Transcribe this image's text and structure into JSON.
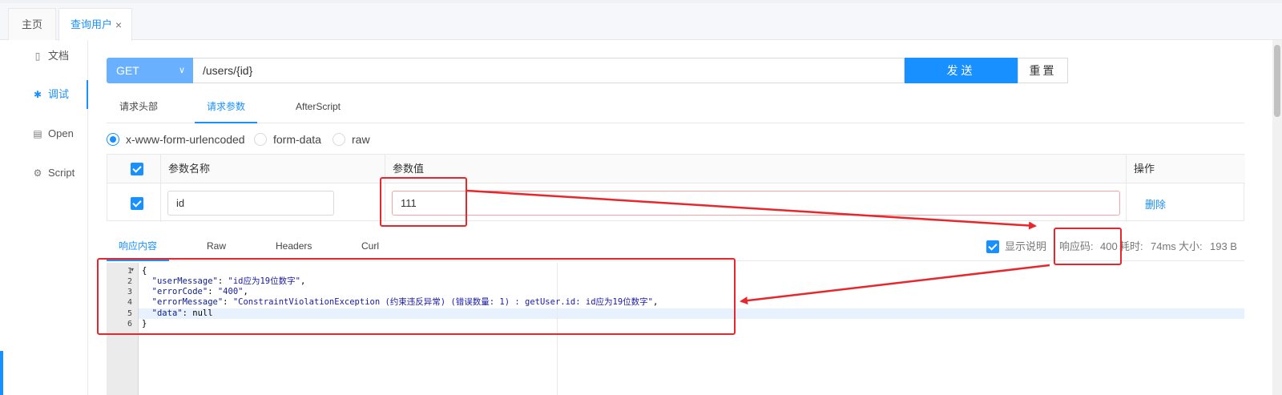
{
  "tabs": [
    {
      "label": "主页"
    },
    {
      "label": "查询用户",
      "close": "×"
    }
  ],
  "sidebar": {
    "items": [
      {
        "label": "文档",
        "icon": "doc-icon"
      },
      {
        "label": "调试",
        "icon": "bug-icon",
        "active": true
      },
      {
        "label": "Open",
        "icon": "file-icon"
      },
      {
        "label": "Script",
        "icon": "gear-icon"
      }
    ]
  },
  "request": {
    "method": "GET",
    "url": "/users/{id}",
    "send_label": "发送",
    "reset_label": "重置"
  },
  "request_tabs": [
    {
      "label": "请求头部"
    },
    {
      "label": "请求参数",
      "active": true
    },
    {
      "label": "AfterScript"
    }
  ],
  "body_types": [
    {
      "label": "x-www-form-urlencoded",
      "selected": true
    },
    {
      "label": "form-data"
    },
    {
      "label": "raw"
    }
  ],
  "params_table": {
    "headers": [
      "参数名称",
      "参数值",
      "操作"
    ],
    "rows": [
      {
        "name": "id",
        "value": "111",
        "action": "删除",
        "checked": true
      }
    ]
  },
  "response_tabs": [
    {
      "label": "响应内容",
      "active": true
    },
    {
      "label": "Raw"
    },
    {
      "label": "Headers"
    },
    {
      "label": "Curl"
    }
  ],
  "response_info": {
    "show_desc_label": "显示说明",
    "code_label": "响应码:",
    "code": "400",
    "time_label": "耗时:",
    "time": "74ms",
    "size_label": "大小:",
    "size": "193 B"
  },
  "response_body": {
    "line_numbers": [
      "1",
      "2",
      "3",
      "4",
      "5",
      "6"
    ],
    "open_brace": "{",
    "close_brace": "}",
    "lines": [
      {
        "key": "\"userMessage\"",
        "sep": ": ",
        "value": "\"id应为19位数字\"",
        "end": ","
      },
      {
        "key": "\"errorCode\"",
        "sep": ": ",
        "value": "\"400\"",
        "end": ","
      },
      {
        "key": "\"errorMessage\"",
        "sep": ": ",
        "value": "\"ConstraintViolationException (约束违反异常) (错误数量: 1) : getUser.id: id应为19位数字\"",
        "end": ","
      },
      {
        "key": "\"data\"",
        "sep": ": ",
        "value": "null",
        "end": ""
      }
    ]
  },
  "colors": {
    "accent": "#1890ff",
    "method_bg": "#69b1ff",
    "success_value": "#1aaa55",
    "annotation": "#e8262b"
  }
}
